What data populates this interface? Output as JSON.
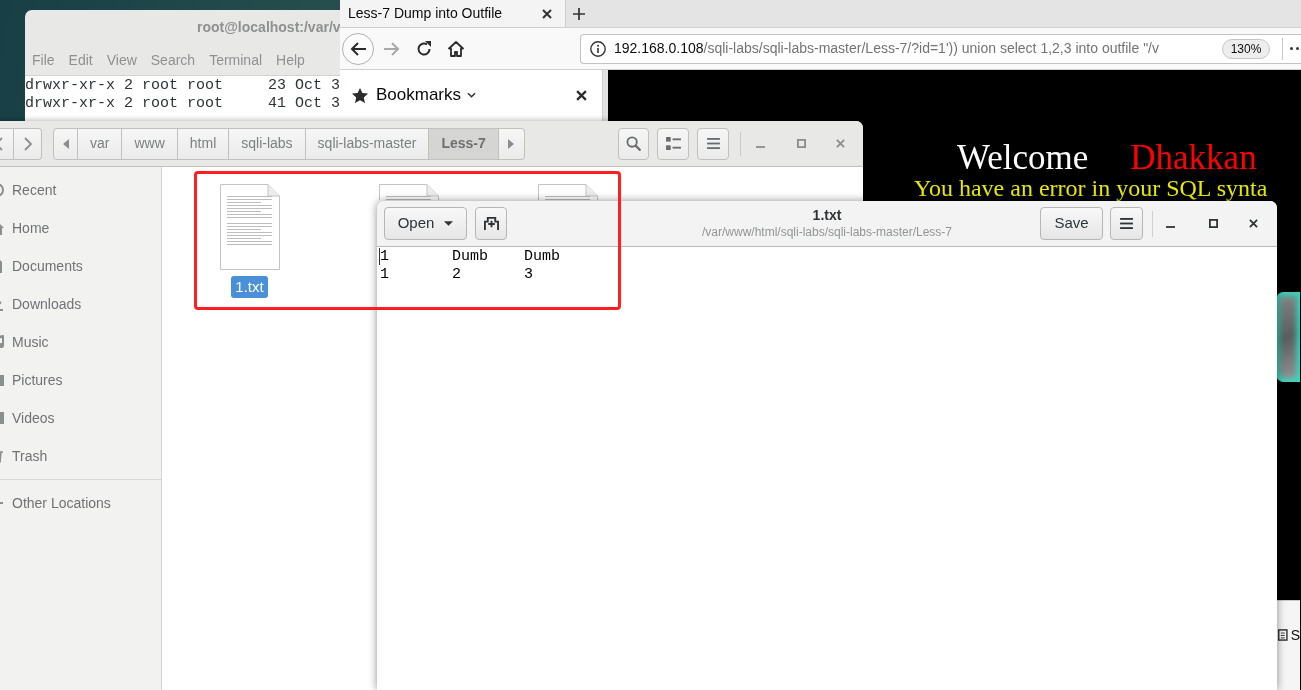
{
  "terminal": {
    "title": "root@localhost:/var/v",
    "menu": [
      "File",
      "Edit",
      "View",
      "Search",
      "Terminal",
      "Help"
    ],
    "lines": [
      "drwxr-xr-x 2 root root     23 Oct 3",
      "drwxr-xr-x 2 root root     41 Oct 3"
    ]
  },
  "browser": {
    "tabs": [
      {
        "label": "Less-7 Dump into Outfile",
        "selected": true
      }
    ],
    "forward": {
      "disabled": true
    },
    "address": {
      "host": "192.168.0.108",
      "path": "/sqli-labs/sqli-labs-master/Less-7/?id=1')) union select 1,2,3 into outfile \"/v"
    },
    "zoom": "130%",
    "sidebar": {
      "title": "Bookmarks"
    },
    "page": {
      "heading": [
        {
          "text": "Welcome",
          "color": "#ffffff"
        },
        {
          "text": "Dhakkan",
          "color": "#ff0000"
        }
      ],
      "message": "You have an error in your SQL synta"
    },
    "panel": {
      "label": "S"
    }
  },
  "files": {
    "path": [
      {
        "label": "var",
        "selected": false
      },
      {
        "label": "www",
        "selected": false
      },
      {
        "label": "html",
        "selected": false
      },
      {
        "label": "sqli-labs",
        "selected": false
      },
      {
        "label": "sqli-labs-master",
        "selected": false
      },
      {
        "label": "Less-7",
        "selected": true
      }
    ],
    "places": [
      {
        "kind": "recent",
        "label": "Recent",
        "selected": false
      },
      {
        "kind": "home",
        "label": "Home",
        "selected": false
      },
      {
        "kind": "documents",
        "label": "Documents",
        "selected": false
      },
      {
        "kind": "downloads",
        "label": "Downloads",
        "selected": false
      },
      {
        "kind": "music",
        "label": "Music",
        "selected": false
      },
      {
        "kind": "pictures",
        "label": "Pictures",
        "selected": false
      },
      {
        "kind": "videos",
        "label": "Videos",
        "selected": false
      },
      {
        "kind": "trash",
        "label": "Trash",
        "selected": false
      },
      {
        "kind": "other",
        "label": "Other Locations",
        "selected": false
      }
    ],
    "items": [
      {
        "name": "1.txt",
        "selected": true
      },
      {
        "selected": false
      },
      {
        "selected": false
      }
    ]
  },
  "editor": {
    "open_button": "Open",
    "title": "1.txt",
    "subtitle": "/var/www/html/sqli-labs/sqli-labs-master/Less-7",
    "save_button": "Save",
    "lines": [
      "1\tDumb\tDumb",
      "1\t2\t3"
    ]
  }
}
